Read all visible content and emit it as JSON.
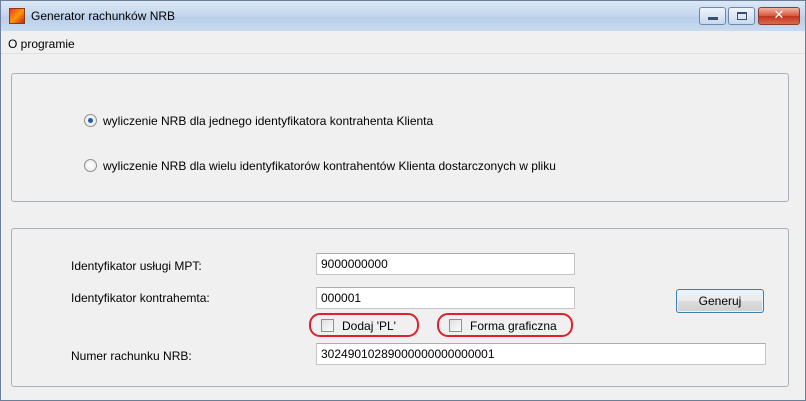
{
  "window": {
    "title": "Generator rachunków NRB",
    "minimize_icon": "minimize-icon",
    "maximize_icon": "maximize-icon",
    "close_icon": "close-icon",
    "close_glyph": "✕"
  },
  "menu": {
    "items": [
      {
        "label": "O programie"
      }
    ]
  },
  "mode": {
    "options": [
      {
        "label": "wyliczenie NRB dla jednego identyfikatora kontrahenta Klienta",
        "selected": true
      },
      {
        "label": "wyliczenie NRB dla wielu identyfikatorów kontrahentów Klienta dostarczonych w pliku",
        "selected": false
      }
    ]
  },
  "form": {
    "service_id": {
      "label": "Identyfikator usługi MPT:",
      "value": "9000000000"
    },
    "contractor_id": {
      "label": "Identyfikator kontrahemta:",
      "value": "000001"
    },
    "add_pl": {
      "label": "Dodaj 'PL'",
      "checked": false
    },
    "graphic_form": {
      "label": "Forma graficzna",
      "checked": false
    },
    "account_number": {
      "label": "Numer rachunku NRB:",
      "value": "30249010289000000000000001"
    },
    "generate_button": "Generuj"
  },
  "colors": {
    "highlight": "#e0202c",
    "radio_selected": "#1e5ea8"
  }
}
